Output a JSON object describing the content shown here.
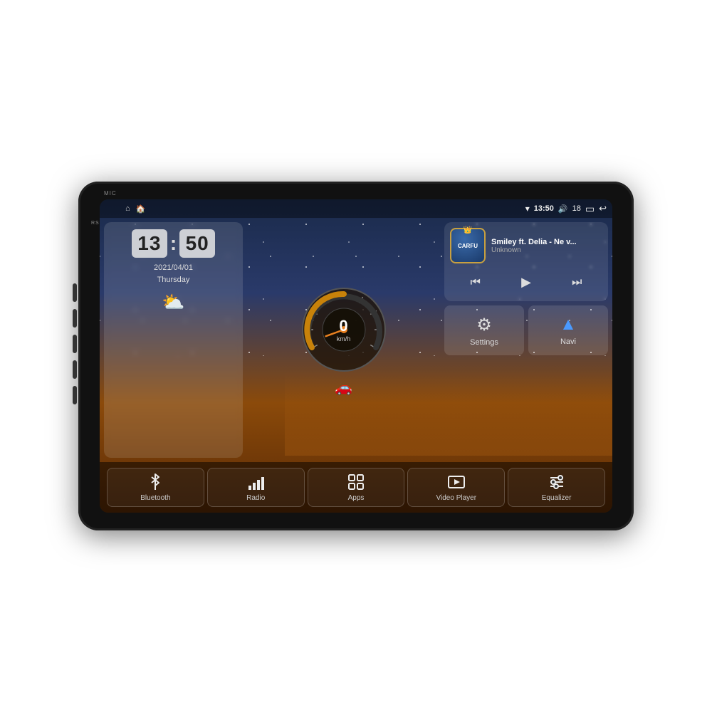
{
  "device": {
    "mic_label": "MIC",
    "rst_label": "RST"
  },
  "status_bar": {
    "icons_left": [
      "⌂",
      "🏠"
    ],
    "wifi_icon": "▼",
    "time": "13:50",
    "volume_icon": "🔊",
    "volume_level": "18",
    "battery_icon": "▬",
    "back_icon": "↩"
  },
  "clock": {
    "hours": "13",
    "minutes": "50",
    "date": "2021/04/01",
    "day": "Thursday",
    "weather_icon": "⛅"
  },
  "speedometer": {
    "speed": "0",
    "unit": "km/h",
    "car_icon": "🚗"
  },
  "music": {
    "title": "Smiley ft. Delia - Ne v...",
    "artist": "Unknown",
    "brand": "CARFU",
    "prev_icon": "⏮",
    "play_icon": "▶",
    "next_icon": "⏭"
  },
  "quick_buttons": {
    "settings": {
      "label": "Settings",
      "icon": "⚙"
    },
    "navi": {
      "label": "Navi",
      "icon": "▲"
    }
  },
  "dock": [
    {
      "id": "bluetooth",
      "label": "Bluetooth",
      "icon": "bluetooth"
    },
    {
      "id": "radio",
      "label": "Radio",
      "icon": "radio"
    },
    {
      "id": "apps",
      "label": "Apps",
      "icon": "apps"
    },
    {
      "id": "video",
      "label": "Video Player",
      "icon": "video"
    },
    {
      "id": "equalizer",
      "label": "Equalizer",
      "icon": "equalizer"
    }
  ]
}
